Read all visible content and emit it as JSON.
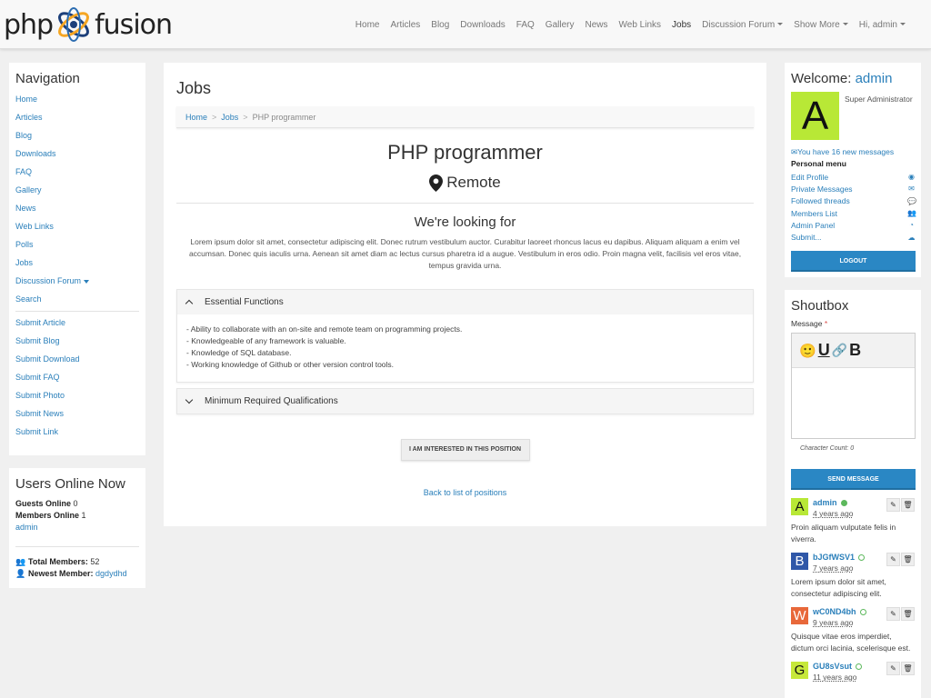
{
  "brand": {
    "left": "php",
    "right": "fusion"
  },
  "nav": [
    {
      "label": "Home"
    },
    {
      "label": "Articles"
    },
    {
      "label": "Blog"
    },
    {
      "label": "Downloads"
    },
    {
      "label": "FAQ"
    },
    {
      "label": "Gallery"
    },
    {
      "label": "News"
    },
    {
      "label": "Web Links"
    },
    {
      "label": "Jobs",
      "active": true
    },
    {
      "label": "Discussion Forum",
      "dropdown": true
    },
    {
      "label": "Show More",
      "dropdown": true
    },
    {
      "label": "Hi, admin",
      "dropdown": true
    }
  ],
  "sidebar": {
    "title": "Navigation",
    "items": [
      "Home",
      "Articles",
      "Blog",
      "Downloads",
      "FAQ",
      "Gallery",
      "News",
      "Web Links",
      "Polls",
      "Jobs",
      "Discussion Forum",
      "Search"
    ],
    "submit_items": [
      "Submit Article",
      "Submit Blog",
      "Submit Download",
      "Submit FAQ",
      "Submit Photo",
      "Submit News",
      "Submit Link"
    ]
  },
  "online": {
    "title": "Users Online Now",
    "guests_label": "Guests Online",
    "guests": "0",
    "members_label": "Members Online",
    "members": "1",
    "member_name": "admin",
    "total_label": "Total Members:",
    "total": "52",
    "newest_label": "Newest Member:",
    "newest": "dgdydhd"
  },
  "main": {
    "heading": "Jobs",
    "breadcrumb": [
      "Home",
      "Jobs",
      "PHP programmer"
    ],
    "job_title": "PHP programmer",
    "location": "Remote",
    "looking_heading": "We're looking for",
    "description": "Lorem ipsum dolor sit amet, consectetur adipiscing elit. Donec rutrum vestibulum auctor. Curabitur laoreet rhoncus lacus eu dapibus. Aliquam aliquam a enim vel accumsan. Donec quis iaculis urna. Aenean sit amet diam ac lectus cursus pharetra id a augue. Vestibulum in eros odio. Proin magna velit, facilisis vel eros vitae, tempus gravida urna.",
    "sections": [
      {
        "title": "Essential Functions",
        "expanded": true,
        "lines": [
          "- Ability to collaborate with an on-site and remote team on programming projects.",
          "- Knowledgeable of any framework is valuable.",
          "- Knowledge of SQL database.",
          "- Working knowledge of Github or other version control tools."
        ]
      },
      {
        "title": "Minimum Required Qualifications",
        "expanded": false
      }
    ],
    "interest_button": "I AM INTERESTED IN THIS POSITION",
    "back_link": "Back to list of positions"
  },
  "welcome": {
    "title_prefix": "Welcome:",
    "username": "admin",
    "avatar_letter": "A",
    "role": "Super Administrator",
    "messages": "You have 16 new messages",
    "menu_title": "Personal menu",
    "menu": [
      {
        "label": "Edit Profile",
        "icon": "user-circle-icon"
      },
      {
        "label": "Private Messages",
        "icon": "envelope-icon"
      },
      {
        "label": "Followed threads",
        "icon": "comments-icon"
      },
      {
        "label": "Members List",
        "icon": "users-icon"
      },
      {
        "label": "Admin Panel",
        "icon": "dashboard-icon"
      },
      {
        "label": "Submit...",
        "icon": "cloud-upload-icon"
      }
    ],
    "logout": "LOGOUT"
  },
  "shoutbox": {
    "title": "Shoutbox",
    "message_label": "Message",
    "required_mark": "*",
    "char_count": "Character Count: 0",
    "send": "SEND MESSAGE",
    "posts": [
      {
        "avatar": "A",
        "color": "#b8e836",
        "name": "admin",
        "online": true,
        "time": "4 years ago",
        "text": "Proin aliquam vulputate felis in viverra."
      },
      {
        "avatar": "B",
        "color": "#2f57a8",
        "name": "bJGfWSV1",
        "online": false,
        "time": "7 years ago",
        "text": "Lorem ipsum dolor sit amet, consectetur adipiscing elit."
      },
      {
        "avatar": "W",
        "color": "#e8683a",
        "name": "wC0ND4bh",
        "online": false,
        "time": "9 years ago",
        "text": "Quisque vitae eros imperdiet, dictum orci lacinia, scelerisque est."
      },
      {
        "avatar": "G",
        "color": "#c6e83a",
        "name": "GU8sVsut",
        "online": false,
        "time": "11 years ago",
        "text": ""
      }
    ]
  },
  "colors": {
    "link": "#2a7fba",
    "button": "#2a87c4",
    "online": "#5cb85c"
  }
}
